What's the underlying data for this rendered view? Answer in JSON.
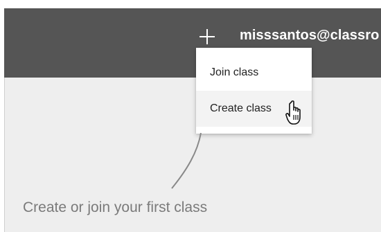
{
  "header": {
    "account_email": "misssantos@classro",
    "add_icon": "plus-icon"
  },
  "add_menu": {
    "items": [
      {
        "label": "Join class"
      },
      {
        "label": "Create class"
      }
    ],
    "cursor_icon": "pointer-hand-icon"
  },
  "main": {
    "empty_message": "Create or join your first class"
  },
  "colors": {
    "header_bg": "#555555",
    "content_bg": "#eeeeee",
    "menu_bg": "#ffffff",
    "hover_bg": "#f3f3f3",
    "text_muted": "#7a7a7a"
  }
}
